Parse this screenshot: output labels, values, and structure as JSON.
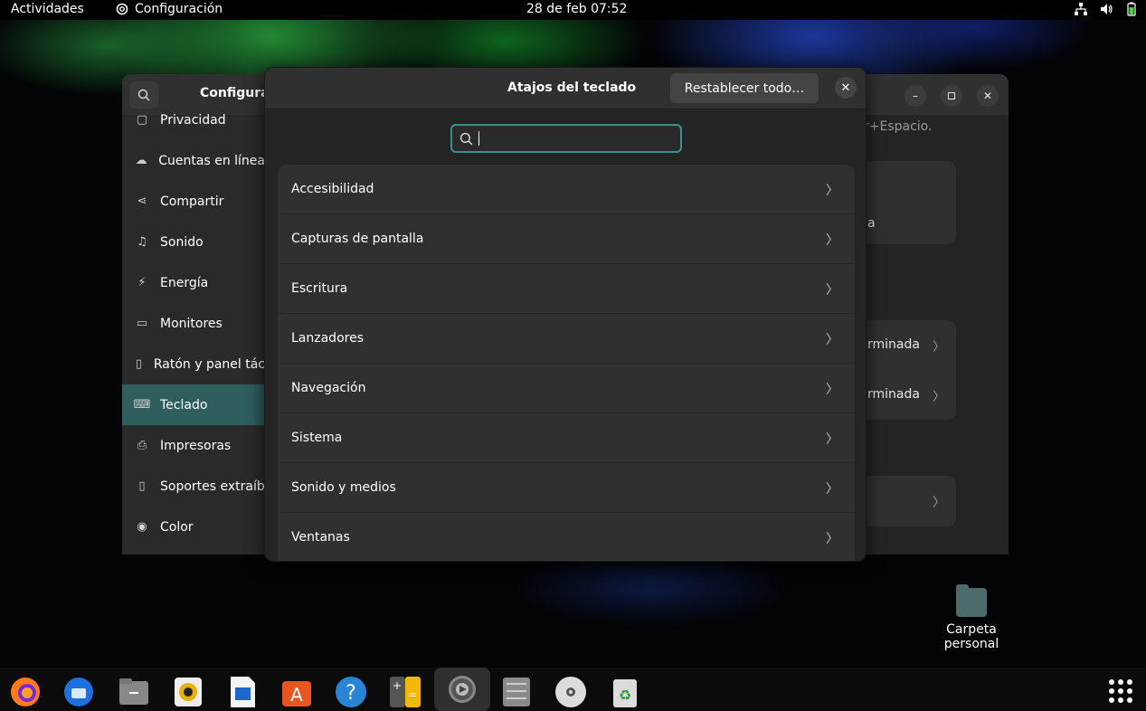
{
  "topbar": {
    "activities": "Actividades",
    "app_menu": "Configuración",
    "clock": "28 de feb  07:52"
  },
  "settings": {
    "title": "Configura",
    "hint": "r+Espacio.",
    "sidebar": [
      {
        "label": "Privacidad",
        "icon": "lock-icon"
      },
      {
        "label": "Cuentas en línea",
        "icon": "cloud-icon"
      },
      {
        "label": "Compartir",
        "icon": "share-icon"
      },
      {
        "label": "Sonido",
        "icon": "music-note-icon"
      },
      {
        "label": "Energía",
        "icon": "power-icon"
      },
      {
        "label": "Monitores",
        "icon": "monitor-icon"
      },
      {
        "label": "Ratón y panel tác",
        "icon": "mouse-icon"
      },
      {
        "label": "Teclado",
        "icon": "keyboard-icon",
        "active": true
      },
      {
        "label": "Impresoras",
        "icon": "printer-icon"
      },
      {
        "label": "Soportes extraíb",
        "icon": "usb-icon"
      },
      {
        "label": "Color",
        "icon": "color-icon"
      }
    ],
    "content_rows": [
      {
        "label": "a"
      },
      {
        "label": "rminada"
      },
      {
        "label": "rminada"
      }
    ]
  },
  "dialog": {
    "title": "Atajos del teclado",
    "reset_label": "Restablecer todo…",
    "search_value": "",
    "search_placeholder": "",
    "categories": [
      "Accesibilidad",
      "Capturas de pantalla",
      "Escritura",
      "Lanzadores",
      "Navegación",
      "Sistema",
      "Sonido y medios",
      "Ventanas"
    ]
  },
  "desktop": {
    "folder_label_line1": "Carpeta",
    "folder_label_line2": "personal"
  },
  "dock": {
    "items": [
      "firefox-icon",
      "thunderbird-icon",
      "files-icon",
      "rhythmbox-icon",
      "writer-icon",
      "app-center-icon",
      "help-icon",
      "calculator-icon",
      "settings-icon",
      "file-manager-icon",
      "disc-icon",
      "trash-icon"
    ]
  },
  "colors": {
    "accent": "#2e5e5e",
    "focus_border": "#3d8f8f",
    "dialog_bg": "#242424"
  }
}
